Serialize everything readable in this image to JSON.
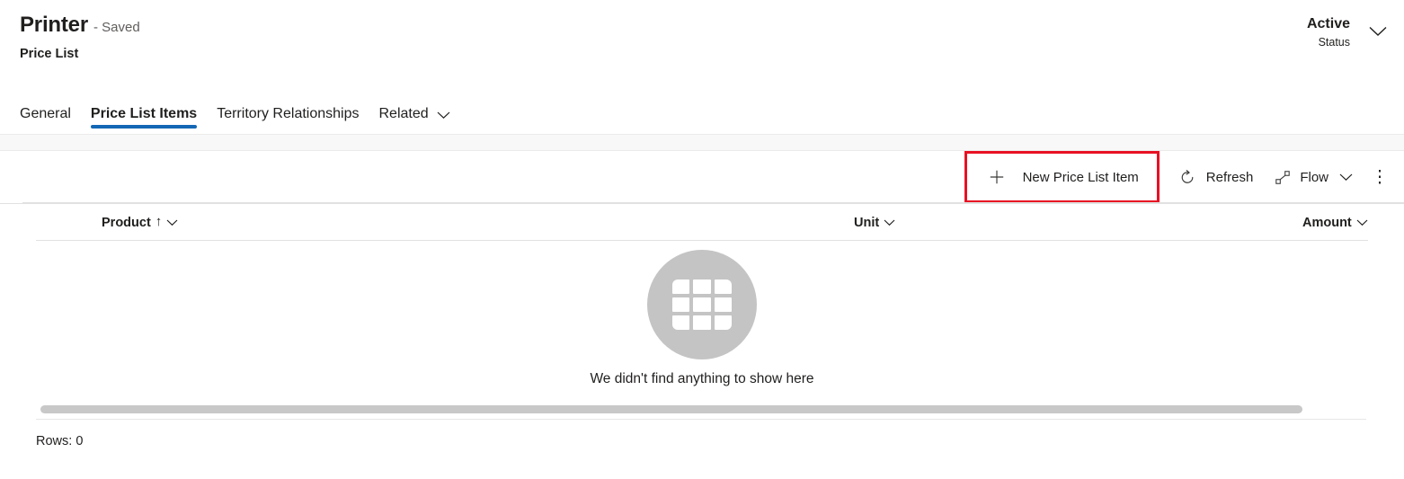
{
  "header": {
    "record_title": "Printer",
    "saved_state": "- Saved",
    "entity_name": "Price List",
    "status": {
      "value": "Active",
      "label": "Status",
      "chevron_icon": "chevron-down-icon"
    }
  },
  "tabs": [
    {
      "label": "General",
      "selected": false
    },
    {
      "label": "Price List Items",
      "selected": true
    },
    {
      "label": "Territory Relationships",
      "selected": false
    },
    {
      "label": "Related",
      "selected": false,
      "chevron_icon": "chevron-down-icon"
    }
  ],
  "command_bar": {
    "new_item": {
      "label": "New Price List Item",
      "icon": "plus-icon",
      "highlighted": true,
      "highlight_color": "#e81123"
    },
    "refresh": {
      "label": "Refresh",
      "icon": "refresh-icon"
    },
    "flow": {
      "label": "Flow",
      "icon": "flow-icon",
      "chevron_icon": "chevron-down-icon"
    },
    "overflow": {
      "label": "⋮",
      "icon": "more-vertical-icon"
    }
  },
  "grid": {
    "columns": [
      {
        "label": "Product",
        "sort_icon": "sort-ascending-arrow-icon",
        "chevron_icon": "chevron-down-icon"
      },
      {
        "label": "Unit",
        "chevron_icon": "chevron-down-icon"
      },
      {
        "label": "Amount",
        "chevron_icon": "chevron-down-icon"
      }
    ],
    "rows": [],
    "empty_state": {
      "message": "We didn't find anything to show here",
      "icon": "empty-grid-illustration",
      "circle_color": "#c4c4c4"
    },
    "footer": {
      "rows_label": "Rows: 0"
    },
    "scrollbar": {
      "orientation": "horizontal",
      "thumb_color": "#c8c8c8"
    }
  },
  "theme": {
    "accent": "#1367b4",
    "highlight": "#e81123",
    "text": "#201f1e",
    "muted_text": "#605e5c",
    "band": "#f8f8f8",
    "border": "#e1e1e1"
  }
}
